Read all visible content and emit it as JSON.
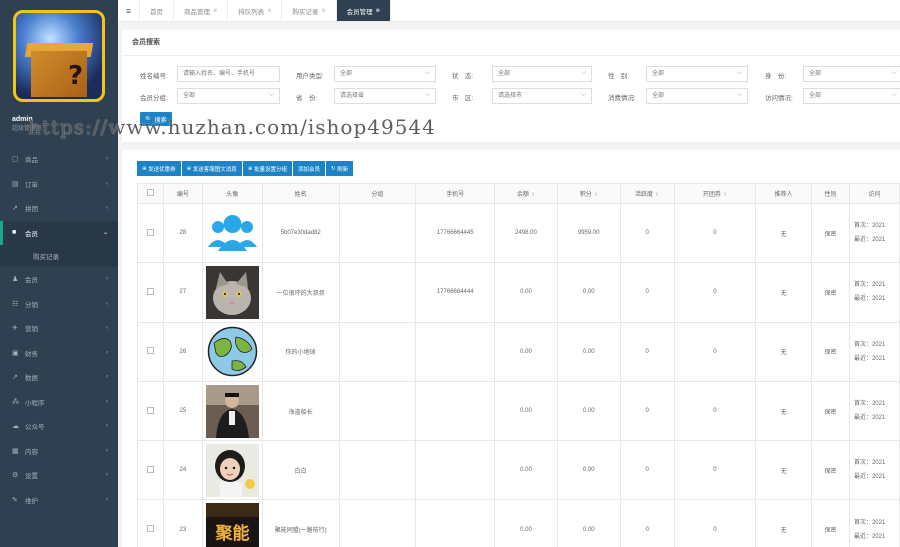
{
  "sidebar": {
    "user": {
      "name": "admin",
      "role": "超级管理员"
    },
    "items": [
      {
        "icon": "▢",
        "label": "商品"
      },
      {
        "icon": "▤",
        "label": "订单"
      },
      {
        "icon": "↗",
        "label": "拼团"
      },
      {
        "icon": "■",
        "label": "会员",
        "active": true
      },
      {
        "icon": "♟",
        "label": "会员"
      },
      {
        "icon": "☷",
        "label": "分销"
      },
      {
        "icon": "✈",
        "label": "营销"
      },
      {
        "icon": "▣",
        "label": "财务"
      },
      {
        "icon": "↗",
        "label": "数据"
      },
      {
        "icon": "⁂",
        "label": "小程序"
      },
      {
        "icon": "☁",
        "label": "公众号"
      },
      {
        "icon": "▦",
        "label": "内容"
      },
      {
        "icon": "⚙",
        "label": "设置"
      },
      {
        "icon": "✎",
        "label": "维护"
      }
    ],
    "submenu": "购买记录"
  },
  "tabs": [
    {
      "label": "首页"
    },
    {
      "label": "商品管理"
    },
    {
      "label": "排队列表"
    },
    {
      "label": "购买记录"
    },
    {
      "label": "会员管理",
      "active": true
    }
  ],
  "search": {
    "title": "会员搜索",
    "fields": [
      {
        "label": "姓名编号:",
        "value": "请输入姓名、编号、手机号"
      },
      {
        "label": "用户类型:",
        "value": "全部"
      },
      {
        "label": "状　态:",
        "value": "全部"
      },
      {
        "label": "性　别:",
        "value": "全部"
      },
      {
        "label": "身　份:",
        "value": "全部"
      },
      {
        "label": "会员分组:",
        "value": "全部"
      },
      {
        "label": "省　份:",
        "value": "请选择省"
      },
      {
        "label": "市　区:",
        "value": "请选择市"
      },
      {
        "label": "消费情况:",
        "value": "全部"
      },
      {
        "label": "访问情况:",
        "value": "全部"
      }
    ],
    "button": "搜索"
  },
  "watermark": "https://www.huzhan.com/ishop49544",
  "toolbar": [
    "发送优惠券",
    "发送客服图文消息",
    "批量设置分组",
    "添加会员",
    "刷新"
  ],
  "table": {
    "headers": [
      "",
      "编号",
      "头像",
      "姓名",
      "分组",
      "手机号",
      "余额",
      "积分",
      "活跃度",
      "开团券",
      "推荐人",
      "性别",
      "访问"
    ],
    "rows": [
      {
        "id": "28",
        "avatar": "users",
        "name": "5b07e30dad82",
        "group": "",
        "phone": "17766664445",
        "balance": "2498.00",
        "points": "9959.00",
        "activity": "0",
        "coupon": "0",
        "referrer": "无",
        "gender": "保密",
        "first": "首次：2021",
        "last": "最近：2021"
      },
      {
        "id": "27",
        "avatar": "cat",
        "name": "一位很坏的大叔叔",
        "group": "",
        "phone": "17766664444",
        "balance": "0.00",
        "points": "0.00",
        "activity": "0",
        "coupon": "0",
        "referrer": "无",
        "gender": "保密",
        "first": "首次：2021",
        "last": "最近：2021"
      },
      {
        "id": "26",
        "avatar": "globe",
        "name": "你的小地球",
        "group": "",
        "phone": "",
        "balance": "0.00",
        "points": "0.00",
        "activity": "0",
        "coupon": "0",
        "referrer": "无",
        "gender": "保密",
        "first": "首次：2021",
        "last": "最近：2021"
      },
      {
        "id": "25",
        "avatar": "man",
        "name": "海盗船长",
        "group": "",
        "phone": "",
        "balance": "0.00",
        "points": "0.00",
        "activity": "0",
        "coupon": "0",
        "referrer": "无",
        "gender": "保密",
        "first": "首次：2021",
        "last": "最近：2021"
      },
      {
        "id": "24",
        "avatar": "girl",
        "name": "白白",
        "group": "",
        "phone": "",
        "balance": "0.00",
        "points": "0.00",
        "activity": "0",
        "coupon": "0",
        "referrer": "无",
        "gender": "保密",
        "first": "首次：2021",
        "last": "最近：2021"
      },
      {
        "id": "23",
        "avatar": "poster",
        "name": "聚能同盟(一路前行)",
        "group": "",
        "phone": "",
        "balance": "0.00",
        "points": "0.00",
        "activity": "0",
        "coupon": "0",
        "referrer": "无",
        "gender": "保密",
        "first": "首次：2021",
        "last": "最近：2021"
      }
    ]
  },
  "poster_text": "聚能",
  "colors": {
    "sidebar": "#2f4050",
    "accent": "#1c84c6",
    "active_border": "#19aa8d"
  }
}
